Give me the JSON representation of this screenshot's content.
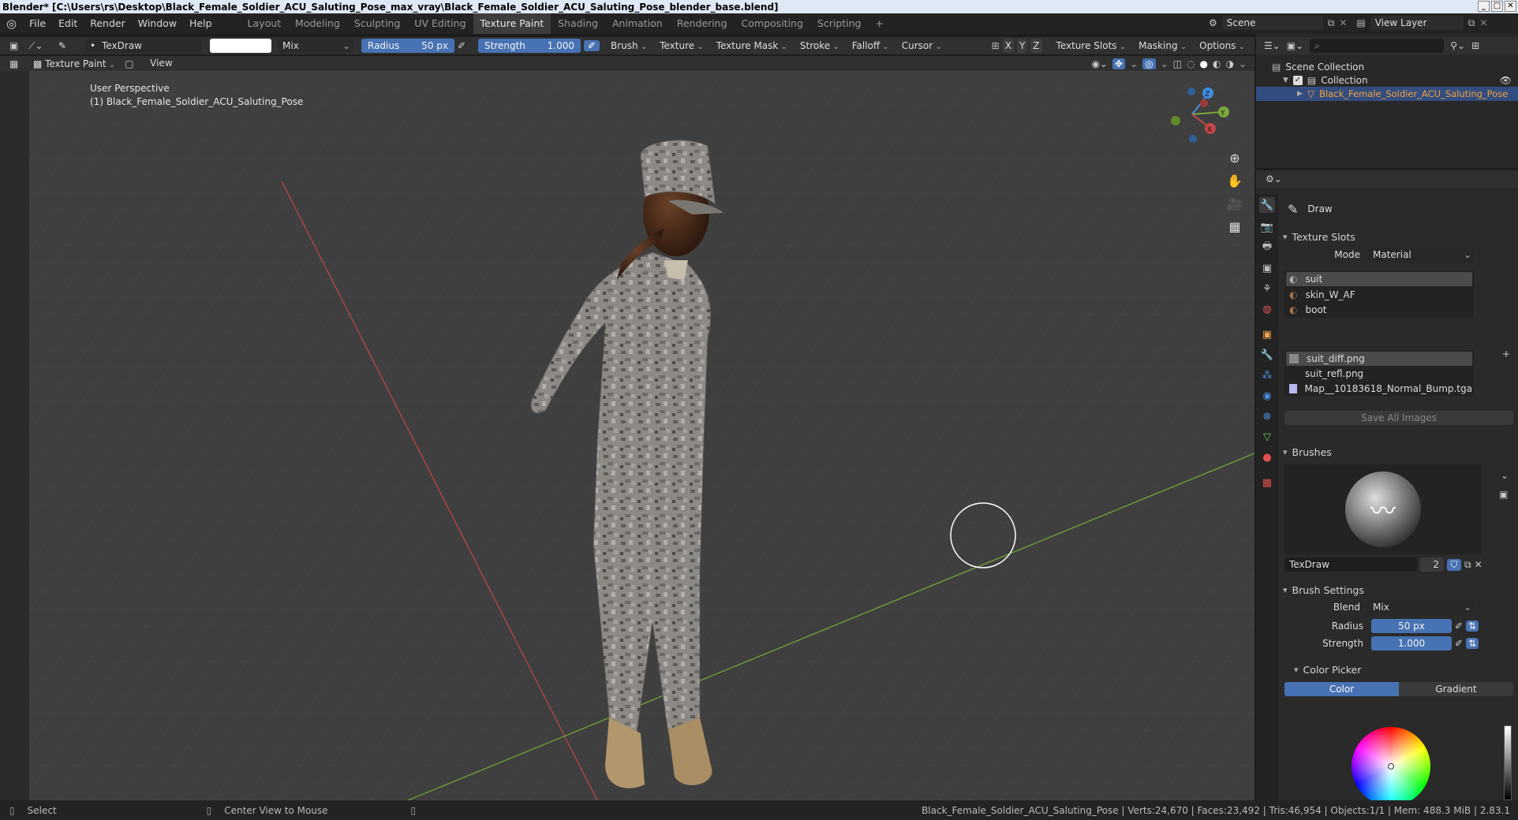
{
  "window": {
    "title": "Blender* [C:\\Users\\rs\\Desktop\\Black_Female_Soldier_ACU_Saluting_Pose_max_vray\\Black_Female_Soldier_ACU_Saluting_Pose_blender_base.blend]"
  },
  "menu": {
    "items": [
      "File",
      "Edit",
      "Render",
      "Window",
      "Help"
    ]
  },
  "workspaces": [
    "Layout",
    "Modeling",
    "Sculpting",
    "UV Editing",
    "Texture Paint",
    "Shading",
    "Animation",
    "Rendering",
    "Compositing",
    "Scripting"
  ],
  "active_workspace": "Texture Paint",
  "scene": {
    "label": "Scene",
    "view_layer": "View Layer"
  },
  "tool_header": {
    "brush_name": "TexDraw",
    "blend": "Mix",
    "radius_label": "Radius",
    "radius_value": "50 px",
    "strength_label": "Strength",
    "strength_value": "1.000",
    "menus": [
      "Brush",
      "Texture",
      "Texture Mask",
      "Stroke",
      "Falloff",
      "Cursor"
    ],
    "axes": [
      "X",
      "Y",
      "Z"
    ],
    "right_menus": [
      "Texture Slots",
      "Masking",
      "Options"
    ]
  },
  "view_header": {
    "mode": "Texture Paint",
    "view": "View"
  },
  "viewport": {
    "perspective": "User Perspective",
    "object_label": "(1) Black_Female_Soldier_ACU_Saluting_Pose",
    "gizmo": {
      "x": "X",
      "y": "Y",
      "z": "Z"
    }
  },
  "outliner": {
    "root": "Scene Collection",
    "collection": "Collection",
    "object": "Black_Female_Soldier_ACU_Saluting_Pose"
  },
  "properties": {
    "tool_name": "Draw",
    "texture_slots": {
      "title": "Texture Slots",
      "mode_label": "Mode",
      "mode_value": "Material",
      "materials": [
        "suit",
        "skin_W_AF",
        "boot"
      ],
      "images": [
        "suit_diff.png",
        "suit_refl.png",
        "Map__10183618_Normal_Bump.tga"
      ],
      "save_all": "Save All Images"
    },
    "brushes": {
      "title": "Brushes",
      "name": "TexDraw",
      "users": "2"
    },
    "brush_settings": {
      "title": "Brush Settings",
      "blend_label": "Blend",
      "blend_value": "Mix",
      "radius_label": "Radius",
      "radius_value": "50 px",
      "strength_label": "Strength",
      "strength_value": "1.000"
    },
    "color_picker": {
      "title": "Color Picker",
      "tab_color": "Color",
      "tab_gradient": "Gradient"
    }
  },
  "status": {
    "select": "Select",
    "center": "Center View to Mouse",
    "info": "Black_Female_Soldier_ACU_Saluting_Pose | Verts:24,670 | Faces:23,492 | Tris:46,954 | Objects:1/1 | Mem: 488.3 MiB | 2.83.1"
  },
  "colors": {
    "accent": "#4772b3",
    "x_axis": "#c44747",
    "y_axis": "#7aa83a",
    "z_axis": "#3f8fe0"
  }
}
